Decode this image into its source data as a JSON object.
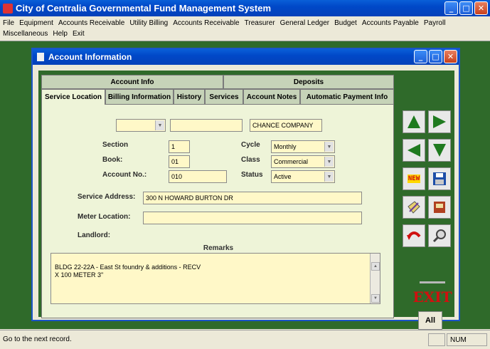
{
  "app": {
    "title": "City of Centralia Governmental Fund Management System",
    "window_buttons": [
      "_",
      "□",
      "✕"
    ]
  },
  "menu": [
    "File",
    "Equipment",
    "Accounts Receivable",
    "Utility Billing",
    "Accounts Receivable",
    "Treasurer",
    "General Ledger",
    "Budget",
    "Accounts Payable",
    "Payroll",
    "Miscellaneous",
    "Help",
    "Exit"
  ],
  "child": {
    "title": "Account Information",
    "window_buttons": [
      "_",
      "□",
      "✕"
    ]
  },
  "tabs": {
    "row1": [
      "Account Info",
      "Deposits"
    ],
    "row2": [
      "Service Location",
      "Billing Information",
      "History",
      "Services",
      "Account Notes",
      "Automatic Payment Info"
    ],
    "active": "Service Location"
  },
  "form": {
    "top_select_value": "",
    "top_field_value": "",
    "company_name": "CHANCE COMPANY",
    "section_label": "Section",
    "section_value": "1",
    "book_label": "Book:",
    "book_value": "01",
    "account_label": "Account No.:",
    "account_value": "010",
    "cycle_label": "Cycle",
    "cycle_value": "Monthly",
    "class_label": "Class",
    "class_value": "Commercial",
    "status_label": "Status",
    "status_value": "Active",
    "service_address_label": "Service Address:",
    "service_address_value": "300 N HOWARD BURTON DR",
    "meter_location_label": "Meter Location:",
    "meter_location_value": "",
    "landlord_label": "Landlord:",
    "remarks_label": "Remarks",
    "remarks_value": "  BLDG 22-22A - East St foundry & additions - RECV\nX 100 METER   3\""
  },
  "side_buttons": {
    "exit_label": "EXIT",
    "new_label": "NEW",
    "all_label": "All",
    "icons": [
      "first-record-icon",
      "next-record-icon",
      "previous-record-icon",
      "last-record-icon",
      "new-record-icon",
      "save-icon",
      "edit-icon",
      "print-icon",
      "undo-icon",
      "search-icon"
    ]
  },
  "status": {
    "message": "Go to the next record.",
    "num": "NUM"
  },
  "colors": {
    "title_bar": "#0541b9",
    "desktop_green": "#2f6a2a",
    "field_yellow": "#fff8c8",
    "panel_bg": "#eef4d8",
    "arrow_green": "#1f7a1f",
    "exit_red": "#d01010"
  }
}
